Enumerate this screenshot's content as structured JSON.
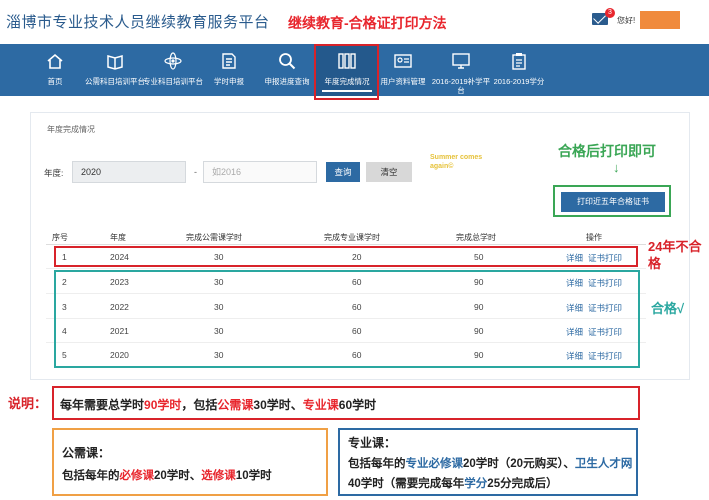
{
  "header": {
    "site_title": "淄博市专业技术人员继续教育服务平台",
    "banner": "继续教育-合格证打印方法",
    "mail_badge": "3",
    "greeting": "您好!"
  },
  "nav": [
    {
      "label": "首页",
      "icon": "home-icon"
    },
    {
      "label": "公需科目培训平台",
      "icon": "book-icon"
    },
    {
      "label": "专业科目培训平台",
      "icon": "atom-icon"
    },
    {
      "label": "学时申报",
      "icon": "document-icon"
    },
    {
      "label": "申报进度查询",
      "icon": "search-icon"
    },
    {
      "label": "年度完成情况",
      "icon": "binders-icon"
    },
    {
      "label": "用户资料管理",
      "icon": "id-card-icon"
    },
    {
      "label": "2016-2019补学平台",
      "icon": "monitor-icon"
    },
    {
      "label": "2016-2019学分",
      "icon": "clipboard-icon"
    }
  ],
  "panel": {
    "title": "年度完成情况",
    "year_label": "年度:",
    "year_value": "2020",
    "year_placeholder": "如2016",
    "query_label": "查询",
    "clear_label": "清空",
    "watermark": "Summer comes again©",
    "print_label": "打印近五年合格证书"
  },
  "table": {
    "headers": [
      "序号",
      "年度",
      "完成公需课学时",
      "完成专业课学时",
      "完成总学时",
      "操作"
    ],
    "rows": [
      {
        "no": "1",
        "year": "2024",
        "public": "30",
        "pro": "20",
        "total": "50",
        "detail": "详细",
        "print": "证书打印"
      },
      {
        "no": "2",
        "year": "2023",
        "public": "30",
        "pro": "60",
        "total": "90",
        "detail": "详细",
        "print": "证书打印"
      },
      {
        "no": "3",
        "year": "2022",
        "public": "30",
        "pro": "60",
        "total": "90",
        "detail": "详细",
        "print": "证书打印"
      },
      {
        "no": "4",
        "year": "2021",
        "public": "30",
        "pro": "60",
        "total": "90",
        "detail": "详细",
        "print": "证书打印"
      },
      {
        "no": "5",
        "year": "2020",
        "public": "30",
        "pro": "60",
        "total": "90",
        "detail": "详细",
        "print": "证书打印"
      }
    ]
  },
  "annotations": {
    "print_hint": "合格后打印即可",
    "arrow": "↓",
    "fail_note": "24年不合格",
    "pass_note": "合格√",
    "explain": "说明：",
    "rule": {
      "a": "每年需要总学时",
      "b": "90学时",
      "c": "，包括",
      "d": "公需课",
      "e": "30学时、",
      "f": "专业课",
      "g": "60学时"
    },
    "public_box": {
      "head": "公需课：",
      "a": "包括每年的",
      "b": "必修课",
      "c": "20学时、",
      "d": "选修课",
      "e": "10学时"
    },
    "pro_box": {
      "head": "专业课：",
      "a": "包括每年的",
      "b": "专业必修课",
      "c": "20学时（20元购买）、",
      "d": "卫生人才网",
      "e": "40学时（需要完成每年",
      "f": "学分",
      "g": "25分完成后）"
    }
  }
}
